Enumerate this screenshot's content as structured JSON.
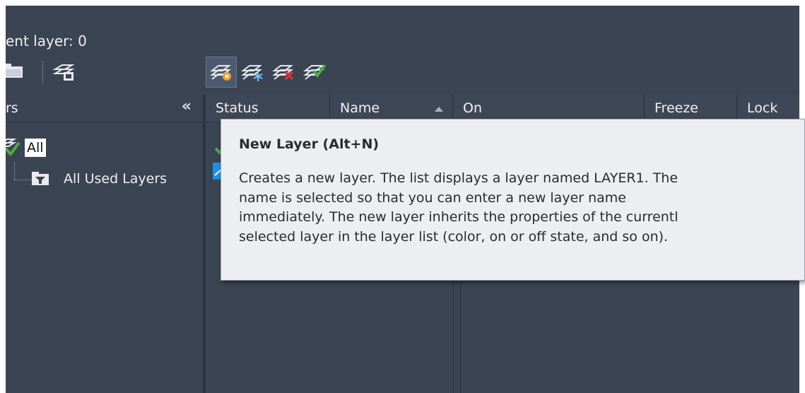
{
  "header": {
    "current_layer_text": "ent layer: 0"
  },
  "toolbar": {
    "left_icons": [
      "folder-icon",
      "layer-filter-icon"
    ],
    "layer_tools": [
      {
        "name": "new-layer-icon",
        "active": true
      },
      {
        "name": "new-layer-vp-frozen-icon",
        "active": false
      },
      {
        "name": "delete-layer-icon",
        "active": false
      },
      {
        "name": "set-current-icon",
        "active": false
      }
    ]
  },
  "left_panel": {
    "title": "rs",
    "collapse_glyph": "«",
    "tree": {
      "root_label": "All",
      "child_label": "All Used Layers"
    }
  },
  "grid": {
    "columns": [
      {
        "key": "status",
        "label": "Status"
      },
      {
        "key": "name",
        "label": "Name"
      },
      {
        "key": "on",
        "label": "On"
      },
      {
        "key": "freeze",
        "label": "Freeze"
      },
      {
        "key": "lock",
        "label": "Lock"
      }
    ]
  },
  "tooltip": {
    "title": "New Layer (Alt+N)",
    "lines": [
      "Creates a new layer. The list displays a layer named LAYER1. The",
      "name is selected so that you can enter a new layer name",
      "immediately. The new layer inherits the properties of the currentl",
      "selected layer in the layer list (color, on or off state, and so on)."
    ]
  },
  "colors": {
    "panel_bg": "#3b4453",
    "accent_blue": "#1e90e8",
    "check_green": "#4caf3a",
    "delete_red": "#e0303a",
    "tooltip_bg": "#eceef2"
  }
}
